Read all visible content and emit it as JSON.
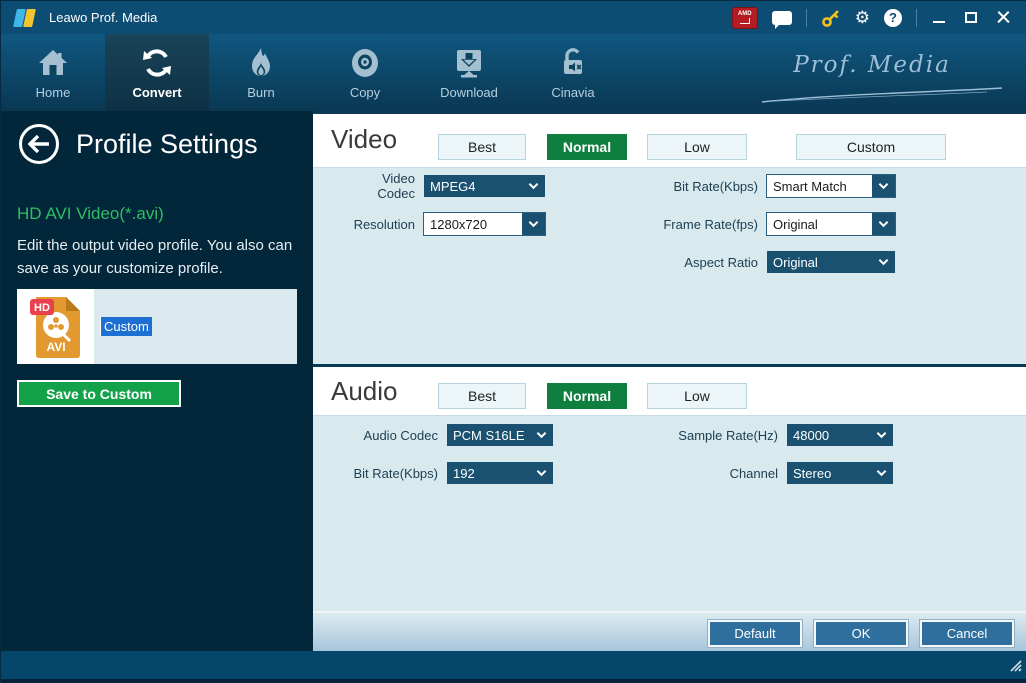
{
  "titlebar": {
    "app_title": "Leawo Prof. Media",
    "amd_badge": "AMD",
    "help_glyph": "?",
    "gear_glyph": "⚙"
  },
  "nav": {
    "brand": "Prof. Media",
    "active": "Convert",
    "items": [
      {
        "label": "Home"
      },
      {
        "label": "Convert"
      },
      {
        "label": "Burn"
      },
      {
        "label": "Copy"
      },
      {
        "label": "Download"
      },
      {
        "label": "Cinavia"
      }
    ]
  },
  "sidebar": {
    "title": "Profile Settings",
    "profile_name": "HD AVI Video(*.avi)",
    "description_line1": "Edit the output video profile. You also can",
    "description_line2": "save as your customize profile.",
    "profile_item": {
      "badge": "HD",
      "format": "AVI",
      "name_value": "Custom"
    },
    "save_button_label": "Save to Custom"
  },
  "video": {
    "section_title": "Video",
    "quality": {
      "best": "Best",
      "normal": "Normal",
      "low": "Low",
      "custom": "Custom",
      "selected": "Normal"
    },
    "fields": {
      "codec": {
        "label": "Video Codec",
        "value": "MPEG4"
      },
      "bitrate": {
        "label": "Bit Rate(Kbps)",
        "value": "Smart Match"
      },
      "resolution": {
        "label": "Resolution",
        "value": "1280x720"
      },
      "framerate": {
        "label": "Frame Rate(fps)",
        "value": "Original"
      },
      "aspect": {
        "label": "Aspect Ratio",
        "value": "Original"
      }
    }
  },
  "audio": {
    "section_title": "Audio",
    "quality": {
      "best": "Best",
      "normal": "Normal",
      "low": "Low",
      "selected": "Normal"
    },
    "fields": {
      "codec": {
        "label": "Audio Codec",
        "value": "PCM S16LE"
      },
      "samplerate": {
        "label": "Sample Rate(Hz)",
        "value": "48000"
      },
      "bitrate": {
        "label": "Bit Rate(Kbps)",
        "value": "192"
      },
      "channel": {
        "label": "Channel",
        "value": "Stereo"
      }
    }
  },
  "footer": {
    "default_label": "Default",
    "ok_label": "OK",
    "cancel_label": "Cancel"
  },
  "colors": {
    "accent_green": "#0e7f3e",
    "green_text": "#2fbe64",
    "selection_blue": "#1d6fd1",
    "dropdown_navy": "#1a5170",
    "button_blue": "#2f6f9e",
    "panel_navy": "#02263a"
  }
}
